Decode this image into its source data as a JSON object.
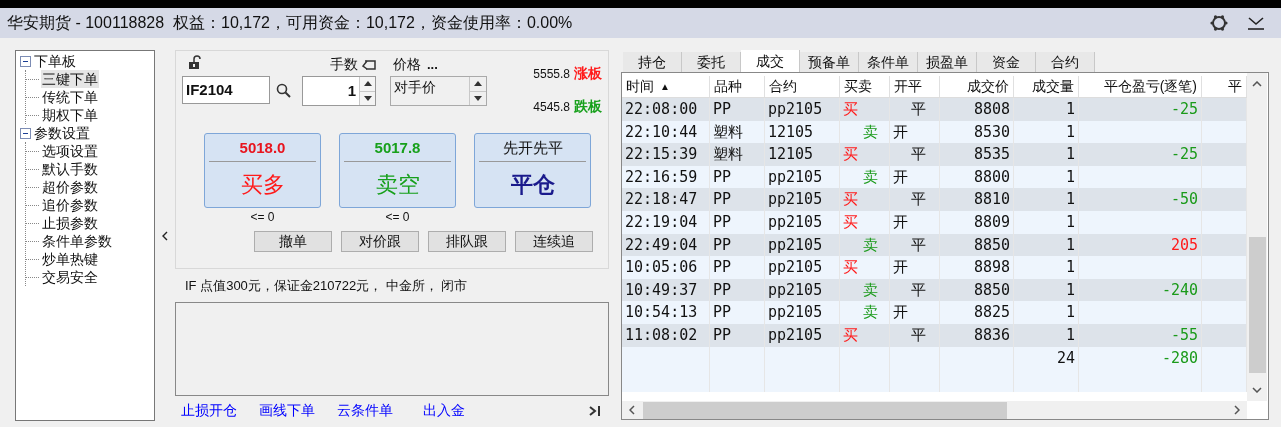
{
  "title": "华安期货 - 100118828  权益：10,172，可用资金：10,172，资金使用率：0.00%",
  "tree": [
    {
      "label": "下单板",
      "expanded": true,
      "children": [
        {
          "label": "三键下单",
          "selected": true
        },
        {
          "label": "传统下单",
          "selected": false
        },
        {
          "label": "期权下单",
          "selected": false
        }
      ]
    },
    {
      "label": "参数设置",
      "expanded": true,
      "children": [
        {
          "label": "选项设置",
          "selected": false
        },
        {
          "label": "默认手数",
          "selected": false
        },
        {
          "label": "超价参数",
          "selected": false
        },
        {
          "label": "追价参数",
          "selected": false
        },
        {
          "label": "止损参数",
          "selected": false
        },
        {
          "label": "条件单参数",
          "selected": false
        },
        {
          "label": "炒单热键",
          "selected": false
        },
        {
          "label": "交易安全",
          "selected": false
        }
      ]
    }
  ],
  "order_panel": {
    "contract_field": {
      "value": "IF2104"
    },
    "lots_label": "手数",
    "lots_field": {
      "value": "1"
    },
    "price_label": "价格",
    "price_more": "...",
    "price_field": {
      "value": "对手价"
    },
    "limits": [
      {
        "price": "5555.8",
        "label": "涨板",
        "kind": "up"
      },
      {
        "price": "4545.8",
        "label": "跌板",
        "kind": "down"
      }
    ],
    "big_buttons": [
      {
        "price": "5018.0",
        "label": "买多",
        "kind": "buy",
        "note": "<= 0"
      },
      {
        "price": "5017.8",
        "label": "卖空",
        "kind": "sell",
        "note": "<= 0"
      },
      {
        "price": "先开先平",
        "label": "平仓",
        "kind": "close"
      }
    ],
    "buttons": [
      "撤单",
      "对价跟",
      "排队跟",
      "连续追"
    ]
  },
  "info": "IF 点值300元，保证金210722元， 中金所， 闭市",
  "links": [
    "止损开仓",
    "画线下单",
    "云条件单",
    "出入金"
  ],
  "tabs": [
    {
      "label": "持仓",
      "selected": false
    },
    {
      "label": "委托",
      "selected": false
    },
    {
      "label": "成交",
      "selected": true
    },
    {
      "label": "预备单",
      "selected": false
    },
    {
      "label": "条件单",
      "selected": false
    },
    {
      "label": "损盈单",
      "selected": false
    },
    {
      "label": "资金",
      "selected": false
    },
    {
      "label": "合约",
      "selected": false
    }
  ],
  "table": {
    "columns": [
      {
        "label": "时间",
        "sort_mark": "▲"
      },
      {
        "label": "品种"
      },
      {
        "label": "合约"
      },
      {
        "label": "买卖"
      },
      {
        "label": "开平"
      },
      {
        "label": "成交价"
      },
      {
        "label": "成交量"
      },
      {
        "label": "平仓盈亏(逐笔)"
      },
      {
        "label": "平"
      }
    ],
    "rows": [
      {
        "time": "22:08:00",
        "variety": "PP",
        "contract": "pp2105",
        "side": {
          "text": "买",
          "kind": "buy"
        },
        "offset": {
          "text": "平",
          "kind": "close"
        },
        "price": "8808",
        "qty": "1",
        "pnl": {
          "text": "-25",
          "kind": "loss"
        }
      },
      {
        "time": "22:10:44",
        "variety": "塑料",
        "contract": "12105",
        "side": {
          "text": "卖",
          "kind": "sell"
        },
        "offset": {
          "text": "开",
          "kind": "open"
        },
        "price": "8530",
        "qty": "1"
      },
      {
        "time": "22:15:39",
        "variety": "塑料",
        "contract": "12105",
        "side": {
          "text": "买",
          "kind": "buy"
        },
        "offset": {
          "text": "平",
          "kind": "close"
        },
        "price": "8535",
        "qty": "1",
        "pnl": {
          "text": "-25",
          "kind": "loss"
        }
      },
      {
        "time": "22:16:59",
        "variety": "PP",
        "contract": "pp2105",
        "side": {
          "text": "卖",
          "kind": "sell"
        },
        "offset": {
          "text": "开",
          "kind": "open"
        },
        "price": "8800",
        "qty": "1"
      },
      {
        "time": "22:18:47",
        "variety": "PP",
        "contract": "pp2105",
        "side": {
          "text": "买",
          "kind": "buy"
        },
        "offset": {
          "text": "平",
          "kind": "close"
        },
        "price": "8810",
        "qty": "1",
        "pnl": {
          "text": "-50",
          "kind": "loss"
        }
      },
      {
        "time": "22:19:04",
        "variety": "PP",
        "contract": "pp2105",
        "side": {
          "text": "买",
          "kind": "buy"
        },
        "offset": {
          "text": "开",
          "kind": "open"
        },
        "price": "8809",
        "qty": "1"
      },
      {
        "time": "22:49:04",
        "variety": "PP",
        "contract": "pp2105",
        "side": {
          "text": "卖",
          "kind": "sell"
        },
        "offset": {
          "text": "平",
          "kind": "close"
        },
        "price": "8850",
        "qty": "1",
        "pnl": {
          "text": "205",
          "kind": "profit"
        }
      },
      {
        "time": "10:05:06",
        "variety": "PP",
        "contract": "pp2105",
        "side": {
          "text": "买",
          "kind": "buy"
        },
        "offset": {
          "text": "开",
          "kind": "open"
        },
        "price": "8898",
        "qty": "1"
      },
      {
        "time": "10:49:37",
        "variety": "PP",
        "contract": "pp2105",
        "side": {
          "text": "卖",
          "kind": "sell"
        },
        "offset": {
          "text": "平",
          "kind": "close"
        },
        "price": "8850",
        "qty": "1",
        "pnl": {
          "text": "-240",
          "kind": "loss"
        }
      },
      {
        "time": "10:54:13",
        "variety": "PP",
        "contract": "pp2105",
        "side": {
          "text": "卖",
          "kind": "sell"
        },
        "offset": {
          "text": "开",
          "kind": "open"
        },
        "price": "8825",
        "qty": "1"
      },
      {
        "time": "11:08:02",
        "variety": "PP",
        "contract": "pp2105",
        "side": {
          "text": "买",
          "kind": "buy"
        },
        "offset": {
          "text": "平",
          "kind": "close"
        },
        "price": "8836",
        "qty": "1",
        "pnl": {
          "text": "-55",
          "kind": "loss"
        }
      }
    ],
    "total": {
      "qty": "24",
      "pnl": {
        "text": "-280",
        "kind": "loss"
      }
    }
  }
}
